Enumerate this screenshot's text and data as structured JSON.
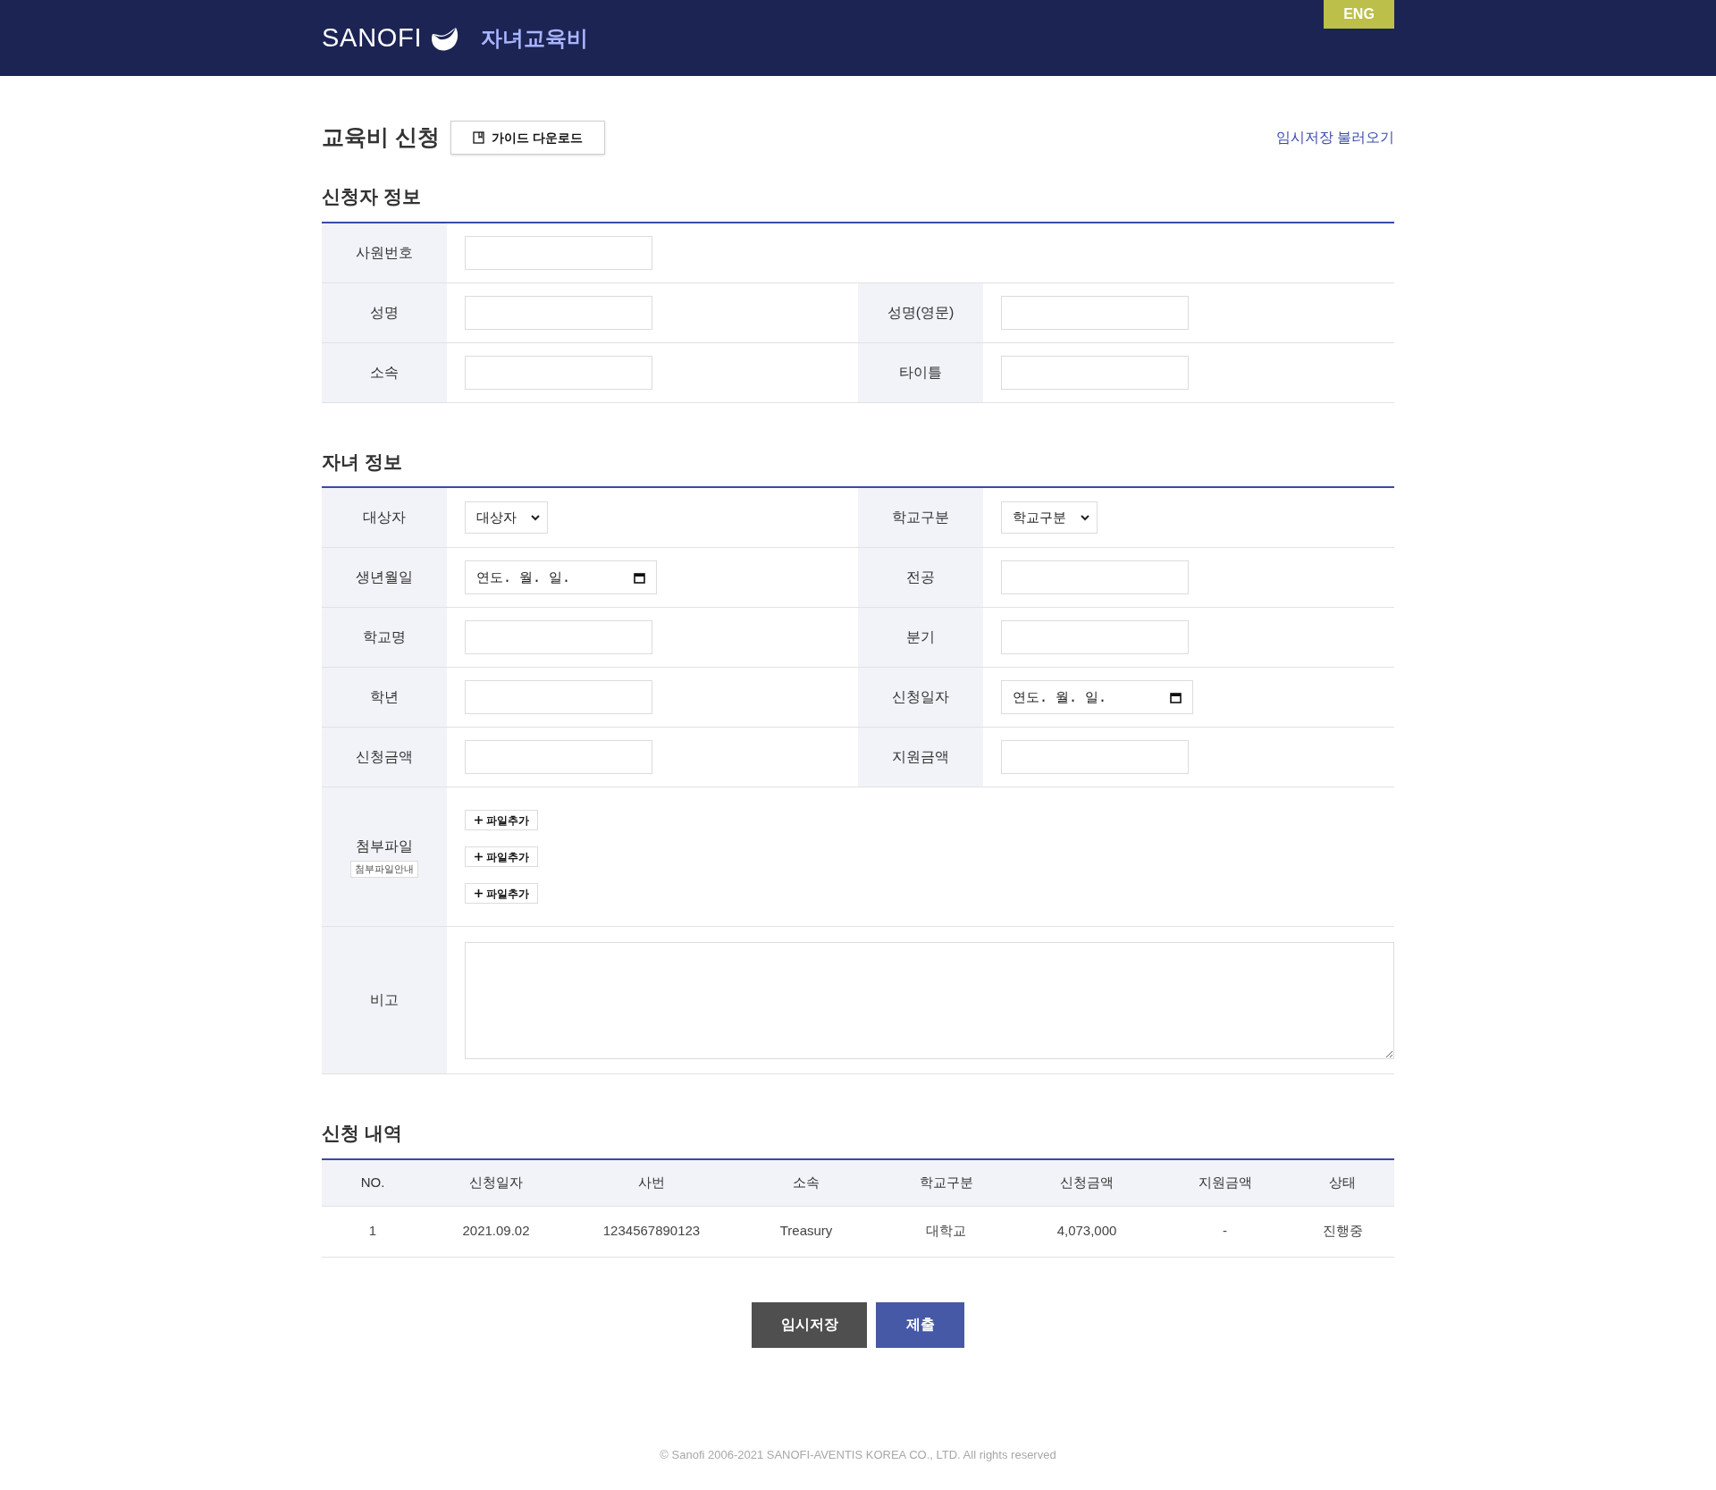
{
  "header": {
    "logo": "SANOFI",
    "app_title": "자녀교육비",
    "language_button": "ENG"
  },
  "page": {
    "title": "교육비 신청",
    "guide_button": "가이드 다운로드",
    "load_link": "임시저장 불러오기"
  },
  "applicant": {
    "title": "신청자 정보",
    "rows": [
      [
        {
          "label": "사원번호",
          "kind": "text"
        }
      ],
      [
        {
          "label": "성명",
          "kind": "text"
        },
        {
          "label": "성명(영문)",
          "kind": "text"
        }
      ],
      [
        {
          "label": "소속",
          "kind": "text"
        },
        {
          "label": "타이틀",
          "kind": "text"
        }
      ]
    ]
  },
  "child": {
    "title": "자녀 정보",
    "rows": [
      [
        {
          "label": "대상자",
          "kind": "select",
          "value": "대상자"
        },
        {
          "label": "학교구분",
          "kind": "select",
          "value": "학교구분"
        }
      ],
      [
        {
          "label": "생년월일",
          "kind": "date",
          "value": "연도. 월. 일."
        },
        {
          "label": "전공",
          "kind": "text"
        }
      ],
      [
        {
          "label": "학교명",
          "kind": "text"
        },
        {
          "label": "분기",
          "kind": "text"
        }
      ],
      [
        {
          "label": "학년",
          "kind": "text"
        },
        {
          "label": "신청일자",
          "kind": "date",
          "value": "연도. 월. 일."
        }
      ],
      [
        {
          "label": "신청금액",
          "kind": "text"
        },
        {
          "label": "지원금액",
          "kind": "text"
        }
      ],
      [
        {
          "label": "첨부파일",
          "kind": "files",
          "note": "첨부파일안내",
          "buttons": [
            "파일추가",
            "파일추가",
            "파일추가"
          ]
        }
      ],
      [
        {
          "label": "비고",
          "kind": "textarea"
        }
      ]
    ]
  },
  "history": {
    "title": "신청 내역",
    "columns": [
      "NO.",
      "신청일자",
      "사번",
      "소속",
      "학교구분",
      "신청금액",
      "지원금액",
      "상태"
    ],
    "rows": [
      [
        "1",
        "2021.09.02",
        "1234567890123",
        "Treasury",
        "대학교",
        "4,073,000",
        "-",
        "진행중"
      ]
    ]
  },
  "actions": [
    {
      "label": "임시저장",
      "kind": "save"
    },
    {
      "label": "제출",
      "kind": "submit"
    }
  ],
  "footer": "© Sanofi 2006-2021 SANOFI-AVENTIS KOREA CO., LTD. All rights reserved"
}
